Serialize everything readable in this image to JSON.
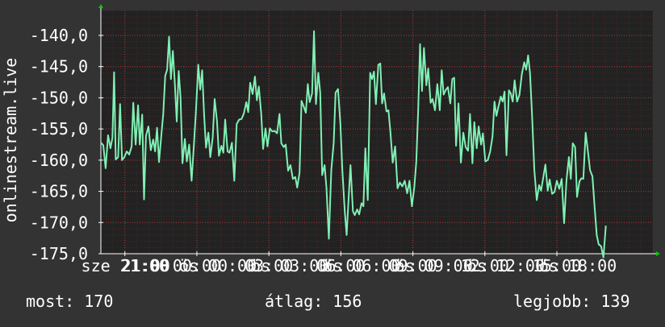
{
  "chart_data": {
    "type": "line",
    "ylabel": "onlinestream.live",
    "ylim": [
      -175,
      -136
    ],
    "y_ticks": [
      -140,
      -145,
      -150,
      -155,
      -160,
      -165,
      -170,
      -175
    ],
    "y_tick_labels": [
      "-140,0",
      "-145,0",
      "-150,0",
      "-155,0",
      "-160,0",
      "-165,0",
      "-170,0",
      "-175,0"
    ],
    "xlim": [
      0,
      23
    ],
    "x_ticks": [
      1,
      4,
      7,
      10,
      13,
      16,
      19
    ],
    "x_tick_labels": [
      "sze 21:00",
      "00:00",
      "03:00",
      "06:00",
      "09:00",
      "12:00",
      "15:00"
    ],
    "x_tick_labels_overlay": [
      "21:00",
      "ös 00:00",
      "ös 03:00",
      "ös 06:00",
      "ös 09:00",
      "ös 12:00",
      "ös 18:00"
    ],
    "grid": true,
    "colors": {
      "line": "#80f0b4",
      "grid": "#6a2e2e",
      "axis": "#ffffff",
      "plot_bg": "#222222",
      "arrow": "#00cc00"
    },
    "series": [
      {
        "values": [
          [
            0.0,
            -157.2
          ],
          [
            0.1,
            -157.6
          ],
          [
            0.2,
            -161.3
          ],
          [
            0.3,
            -156.0
          ],
          [
            0.4,
            -158.1
          ],
          [
            0.48,
            -156.4
          ],
          [
            0.55,
            -145.9
          ],
          [
            0.62,
            -159.9
          ],
          [
            0.72,
            -159.5
          ],
          [
            0.8,
            -151.0
          ],
          [
            0.88,
            -160.0
          ],
          [
            0.98,
            -159.5
          ],
          [
            1.08,
            -158.6
          ],
          [
            1.18,
            -159.1
          ],
          [
            1.28,
            -157.8
          ],
          [
            1.35,
            -150.8
          ],
          [
            1.45,
            -157.5
          ],
          [
            1.55,
            -151.2
          ],
          [
            1.62,
            -157.5
          ],
          [
            1.72,
            -152.7
          ],
          [
            1.8,
            -166.3
          ],
          [
            1.88,
            -156.1
          ],
          [
            1.98,
            -154.6
          ],
          [
            2.08,
            -158.4
          ],
          [
            2.18,
            -156.7
          ],
          [
            2.26,
            -158.6
          ],
          [
            2.34,
            -154.8
          ],
          [
            2.42,
            -160.3
          ],
          [
            2.52,
            -156.0
          ],
          [
            2.6,
            -152.6
          ],
          [
            2.68,
            -146.5
          ],
          [
            2.76,
            -145.5
          ],
          [
            2.84,
            -140.2
          ],
          [
            2.92,
            -147.0
          ],
          [
            3.0,
            -142.5
          ],
          [
            3.08,
            -147.6
          ],
          [
            3.16,
            -153.8
          ],
          [
            3.24,
            -145.7
          ],
          [
            3.32,
            -149.9
          ],
          [
            3.4,
            -160.5
          ],
          [
            3.5,
            -156.6
          ],
          [
            3.58,
            -160.2
          ],
          [
            3.68,
            -157.5
          ],
          [
            3.78,
            -163.3
          ],
          [
            3.88,
            -157.3
          ],
          [
            3.96,
            -152.1
          ],
          [
            4.06,
            -144.7
          ],
          [
            4.14,
            -148.7
          ],
          [
            4.22,
            -145.6
          ],
          [
            4.3,
            -152.7
          ],
          [
            4.38,
            -158.0
          ],
          [
            4.48,
            -155.6
          ],
          [
            4.56,
            -159.5
          ],
          [
            4.66,
            -156.3
          ],
          [
            4.74,
            -150.2
          ],
          [
            4.84,
            -153.8
          ],
          [
            4.92,
            -159.3
          ],
          [
            5.02,
            -157.7
          ],
          [
            5.1,
            -158.8
          ],
          [
            5.18,
            -153.5
          ],
          [
            5.28,
            -158.6
          ],
          [
            5.36,
            -158.8
          ],
          [
            5.46,
            -157.2
          ],
          [
            5.56,
            -163.3
          ],
          [
            5.66,
            -154.2
          ],
          [
            5.76,
            -153.5
          ],
          [
            5.86,
            -153.4
          ],
          [
            5.96,
            -152.5
          ],
          [
            6.06,
            -150.7
          ],
          [
            6.14,
            -152.3
          ],
          [
            6.22,
            -147.6
          ],
          [
            6.32,
            -149.4
          ],
          [
            6.42,
            -146.6
          ],
          [
            6.5,
            -150.4
          ],
          [
            6.58,
            -148.2
          ],
          [
            6.68,
            -152.6
          ],
          [
            6.76,
            -158.2
          ],
          [
            6.86,
            -154.9
          ],
          [
            6.94,
            -157.8
          ],
          [
            7.04,
            -154.9
          ],
          [
            7.14,
            -155.4
          ],
          [
            7.24,
            -155.3
          ],
          [
            7.34,
            -155.7
          ],
          [
            7.44,
            -152.6
          ],
          [
            7.52,
            -157.3
          ],
          [
            7.62,
            -157.9
          ],
          [
            7.7,
            -157.5
          ],
          [
            7.8,
            -161.7
          ],
          [
            7.9,
            -160.8
          ],
          [
            8.0,
            -163.0
          ],
          [
            8.1,
            -162.7
          ],
          [
            8.18,
            -164.4
          ],
          [
            8.28,
            -162.0
          ],
          [
            8.36,
            -150.5
          ],
          [
            8.46,
            -151.5
          ],
          [
            8.54,
            -152.4
          ],
          [
            8.62,
            -147.8
          ],
          [
            8.7,
            -150.7
          ],
          [
            8.8,
            -149.3
          ],
          [
            8.88,
            -139.3
          ],
          [
            8.96,
            -151.0
          ],
          [
            9.06,
            -146.0
          ],
          [
            9.14,
            -149.2
          ],
          [
            9.22,
            -162.4
          ],
          [
            9.32,
            -160.8
          ],
          [
            9.4,
            -164.4
          ],
          [
            9.5,
            -172.6
          ],
          [
            9.6,
            -161.6
          ],
          [
            9.7,
            -157.2
          ],
          [
            9.78,
            -149.2
          ],
          [
            9.88,
            -148.6
          ],
          [
            9.98,
            -154.2
          ],
          [
            10.06,
            -161.6
          ],
          [
            10.16,
            -168.0
          ],
          [
            10.24,
            -172.0
          ],
          [
            10.32,
            -166.3
          ],
          [
            10.4,
            -160.8
          ],
          [
            10.5,
            -168.2
          ],
          [
            10.58,
            -168.8
          ],
          [
            10.68,
            -167.9
          ],
          [
            10.76,
            -168.7
          ],
          [
            10.86,
            -166.9
          ],
          [
            10.94,
            -167.4
          ],
          [
            11.02,
            -158.1
          ],
          [
            11.12,
            -166.4
          ],
          [
            11.22,
            -146.0
          ],
          [
            11.3,
            -147.0
          ],
          [
            11.38,
            -145.8
          ],
          [
            11.46,
            -151.0
          ],
          [
            11.56,
            -144.7
          ],
          [
            11.64,
            -144.5
          ],
          [
            11.72,
            -150.9
          ],
          [
            11.8,
            -149.3
          ],
          [
            11.9,
            -152.2
          ],
          [
            11.98,
            -152.0
          ],
          [
            12.06,
            -155.4
          ],
          [
            12.16,
            -160.4
          ],
          [
            12.26,
            -157.8
          ],
          [
            12.36,
            -164.5
          ],
          [
            12.46,
            -163.6
          ],
          [
            12.56,
            -164.2
          ],
          [
            12.66,
            -163.3
          ],
          [
            12.76,
            -165.3
          ],
          [
            12.86,
            -163.3
          ],
          [
            12.96,
            -167.4
          ],
          [
            13.06,
            -164.3
          ],
          [
            13.14,
            -160.3
          ],
          [
            13.22,
            -151.9
          ],
          [
            13.3,
            -141.4
          ],
          [
            13.38,
            -148.9
          ],
          [
            13.46,
            -142.0
          ],
          [
            13.56,
            -148.0
          ],
          [
            13.64,
            -145.3
          ],
          [
            13.74,
            -150.8
          ],
          [
            13.82,
            -150.2
          ],
          [
            13.92,
            -152.0
          ],
          [
            14.02,
            -147.8
          ],
          [
            14.12,
            -152.0
          ],
          [
            14.2,
            -145.6
          ],
          [
            14.28,
            -149.5
          ],
          [
            14.38,
            -148.7
          ],
          [
            14.46,
            -148.3
          ],
          [
            14.56,
            -150.9
          ],
          [
            14.64,
            -147.0
          ],
          [
            14.72,
            -146.8
          ],
          [
            14.8,
            -157.7
          ],
          [
            14.9,
            -150.9
          ],
          [
            15.0,
            -160.4
          ],
          [
            15.1,
            -155.6
          ],
          [
            15.2,
            -157.9
          ],
          [
            15.3,
            -158.5
          ],
          [
            15.38,
            -152.6
          ],
          [
            15.48,
            -160.5
          ],
          [
            15.56,
            -153.9
          ],
          [
            15.66,
            -158.1
          ],
          [
            15.74,
            -154.6
          ],
          [
            15.84,
            -157.5
          ],
          [
            15.92,
            -155.7
          ],
          [
            16.02,
            -160.2
          ],
          [
            16.12,
            -160.0
          ],
          [
            16.22,
            -158.6
          ],
          [
            16.32,
            -156.2
          ],
          [
            16.4,
            -150.6
          ],
          [
            16.48,
            -152.9
          ],
          [
            16.56,
            -151.5
          ],
          [
            16.66,
            -149.8
          ],
          [
            16.74,
            -150.6
          ],
          [
            16.82,
            -149.0
          ],
          [
            16.9,
            -159.2
          ],
          [
            17.0,
            -148.8
          ],
          [
            17.08,
            -149.3
          ],
          [
            17.16,
            -150.6
          ],
          [
            17.24,
            -147.2
          ],
          [
            17.34,
            -150.6
          ],
          [
            17.44,
            -149.5
          ],
          [
            17.54,
            -146.2
          ],
          [
            17.64,
            -144.3
          ],
          [
            17.72,
            -145.5
          ],
          [
            17.8,
            -143.2
          ],
          [
            17.88,
            -146.0
          ],
          [
            17.96,
            -152.3
          ],
          [
            18.06,
            -161.6
          ],
          [
            18.16,
            -166.4
          ],
          [
            18.26,
            -164.0
          ],
          [
            18.34,
            -164.9
          ],
          [
            18.44,
            -162.6
          ],
          [
            18.52,
            -160.7
          ],
          [
            18.62,
            -164.9
          ],
          [
            18.7,
            -163.1
          ],
          [
            18.8,
            -165.4
          ],
          [
            18.9,
            -165.1
          ],
          [
            19.0,
            -163.3
          ],
          [
            19.1,
            -164.6
          ],
          [
            19.2,
            -163.0
          ],
          [
            19.3,
            -170.1
          ],
          [
            19.4,
            -163.3
          ],
          [
            19.5,
            -159.5
          ],
          [
            19.58,
            -163.0
          ],
          [
            19.66,
            -157.3
          ],
          [
            19.76,
            -157.9
          ],
          [
            19.84,
            -165.9
          ],
          [
            19.94,
            -163.4
          ],
          [
            20.02,
            -162.9
          ],
          [
            20.1,
            -163.0
          ],
          [
            20.2,
            -155.6
          ],
          [
            20.3,
            -158.8
          ],
          [
            20.38,
            -161.6
          ],
          [
            20.48,
            -162.6
          ],
          [
            20.56,
            -166.8
          ],
          [
            20.66,
            -172.0
          ],
          [
            20.74,
            -173.5
          ],
          [
            20.84,
            -173.8
          ],
          [
            20.94,
            -175.6
          ],
          [
            21.04,
            -170.5
          ]
        ]
      }
    ]
  },
  "stats": {
    "current_label": "most:",
    "current_value": "170",
    "average_label": "átlag:",
    "average_value": "156",
    "best_label": "legjobb:",
    "best_value": "139"
  }
}
